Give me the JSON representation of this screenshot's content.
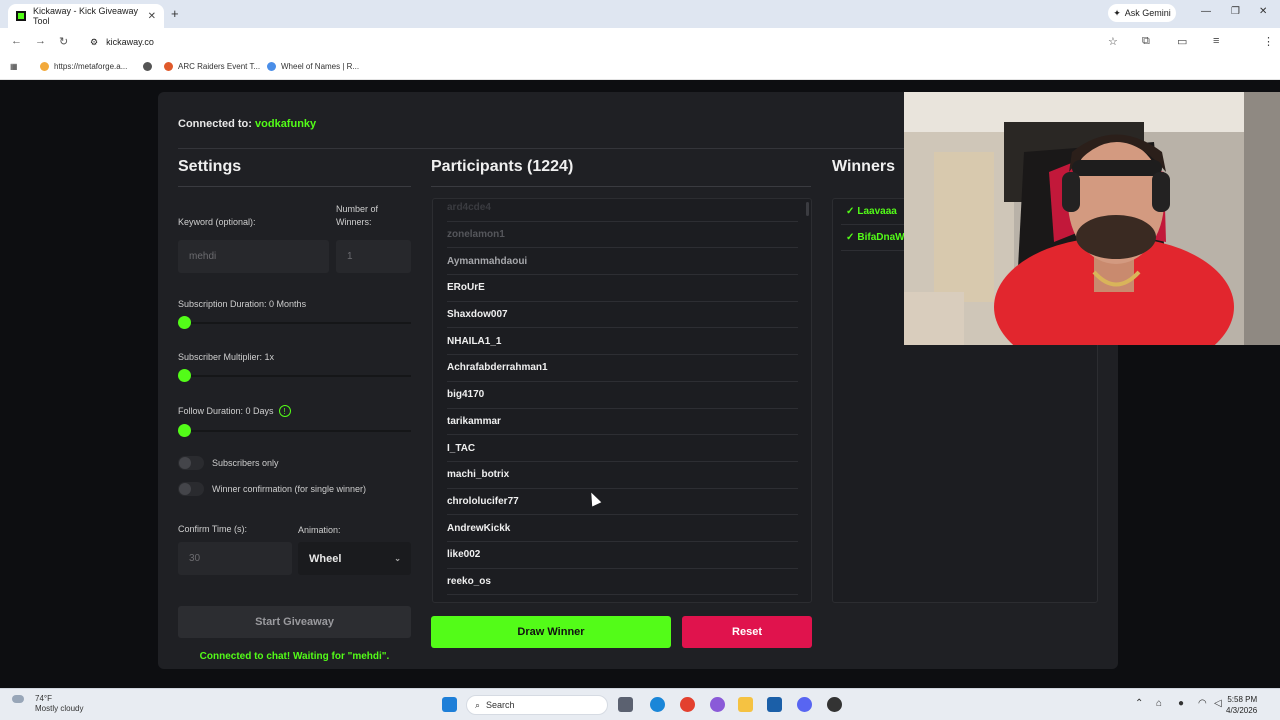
{
  "browser": {
    "tab_title": "Kickaway - Kick Giveaway Tool",
    "url": "kickaway.co",
    "ask_gemini": "Ask Gemini",
    "bookmarks": [
      {
        "label": "https://metaforge.a...",
        "color": "#f2a93b"
      },
      {
        "label": "",
        "color": "#555555"
      },
      {
        "label": "ARC Raiders Event T...",
        "color": "#e05a2b"
      },
      {
        "label": "Wheel of Names | R...",
        "color": "#4a8ee8"
      }
    ]
  },
  "app": {
    "connected_label": "Connected to:",
    "connected_user": "vodkafunky",
    "settings": {
      "title": "Settings",
      "keyword_label": "Keyword (optional):",
      "keyword_value": "mehdi",
      "num_winners_label": "Number of Winners:",
      "num_winners_value": "1",
      "sub_duration_label": "Subscription Duration: 0 Months",
      "sub_multiplier_label": "Subscriber Multiplier: 1x",
      "follow_duration_label": "Follow Duration:  0  Days",
      "subscribers_only_label": "Subscribers only",
      "winner_confirmation_label": "Winner confirmation (for single winner)",
      "confirm_time_label": "Confirm Time (s):",
      "confirm_time_value": "30",
      "animation_label": "Animation:",
      "animation_value": "Wheel",
      "start_button": "Start Giveaway",
      "status": "Connected to chat! Waiting for \"mehdi\"."
    },
    "participants": {
      "title": "Participants (1224)",
      "items": [
        "ard4cde4",
        "zonelamon1",
        "Aymanmahdaoui",
        "ERoUrE",
        "Shaxdow007",
        "NHAILA1_1",
        "Achrafabderrahman1",
        "big4170",
        "tarikammar",
        "I_TAC",
        "machi_botrix",
        "chrololucifer77",
        "AndrewKickk",
        "like002",
        "reeko_os"
      ]
    },
    "draw_button": "Draw Winner",
    "reset_button": "Reset",
    "winners": {
      "title": "Winners",
      "items": [
        "Laavaaa",
        "BifaDnaW"
      ]
    }
  },
  "taskbar": {
    "temp": "74°F",
    "weather": "Mostly cloudy",
    "search_placeholder": "Search",
    "time": "5:58 PM",
    "date": "4/3/2026"
  }
}
